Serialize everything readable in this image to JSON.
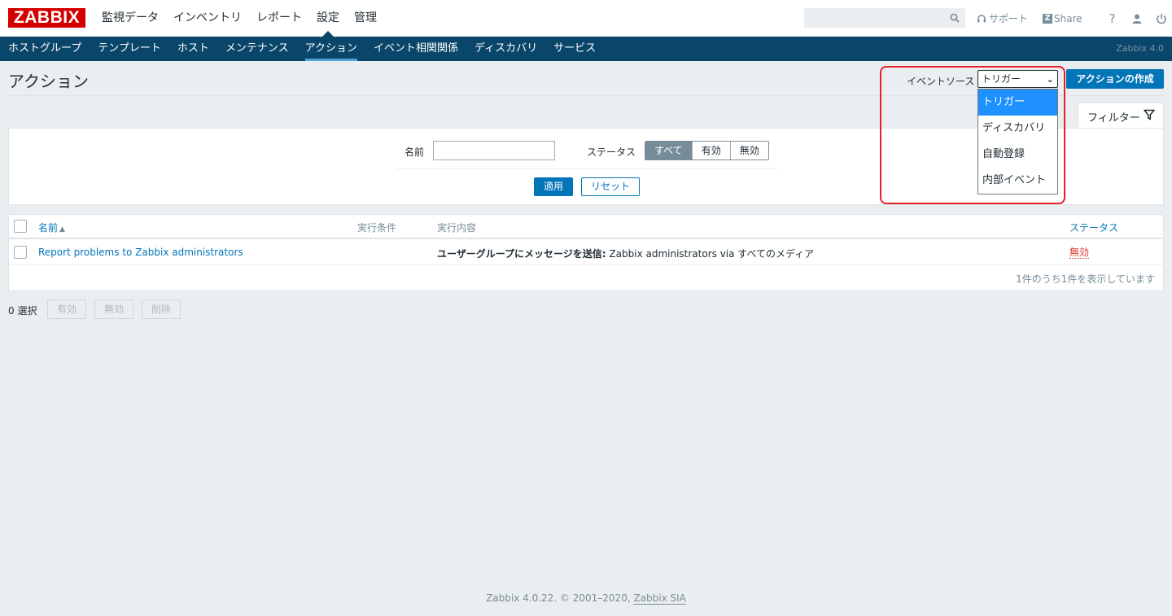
{
  "app": {
    "logo": "ZABBIX",
    "version": "Zabbix 4.0"
  },
  "main_menu": {
    "items": [
      "監視データ",
      "インベントリ",
      "レポート",
      "設定",
      "管理"
    ],
    "active": "設定"
  },
  "top_right": {
    "search_value": "",
    "support_label": "サポート",
    "share_label": "Share",
    "help_icon": "?",
    "user_icon": "user-icon",
    "logout_icon": "power-icon"
  },
  "sub_menu": {
    "items": [
      "ホストグループ",
      "テンプレート",
      "ホスト",
      "メンテナンス",
      "アクション",
      "イベント相関関係",
      "ディスカバリ",
      "サービス"
    ],
    "active": "アクション"
  },
  "header": {
    "title": "アクション",
    "event_source_label": "イベントソース",
    "event_source_value": "トリガー",
    "create_button": "アクションの作成"
  },
  "event_source_dropdown": {
    "options": [
      "トリガー",
      "ディスカバリ",
      "自動登録",
      "内部イベント"
    ],
    "selected": "トリガー"
  },
  "filter": {
    "tab_label": "フィルター",
    "name_label": "名前",
    "name_value": "",
    "status_label": "ステータス",
    "status_options": [
      "すべて",
      "有効",
      "無効"
    ],
    "status_selected": "すべて",
    "apply_button": "適用",
    "reset_button": "リセット"
  },
  "table": {
    "columns": {
      "name": "名前",
      "conditions": "実行条件",
      "operations": "実行内容",
      "status": "ステータス"
    },
    "sort_indicator": "▲",
    "rows": [
      {
        "name": "Report problems to Zabbix administrators",
        "conditions": "",
        "operation_bold": "ユーザーグループにメッセージを送信:",
        "operation_rest": " Zabbix administrators via すべてのメディア",
        "status": "無効"
      }
    ],
    "footer": "1件のうち1件を表示しています"
  },
  "bulk": {
    "selected": "0 選択",
    "buttons": [
      "有効",
      "無効",
      "削除"
    ]
  },
  "footer": {
    "text": "Zabbix 4.0.22. © 2001–2020, ",
    "link": "Zabbix SIA"
  },
  "colors": {
    "brand_red": "#d40000",
    "nav_dark": "#0a466a",
    "primary_blue": "#0275b8",
    "status_red": "#e33734",
    "highlight_frame": "#e8202a"
  }
}
